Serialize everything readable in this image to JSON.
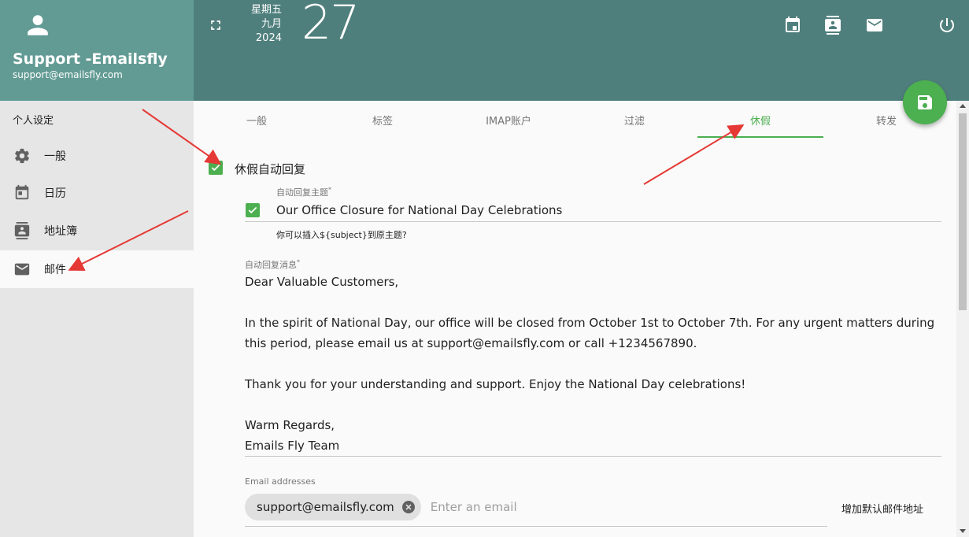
{
  "sidebar": {
    "user_name": "Support -Emailsfly",
    "user_email": "support@emailsfly.com",
    "section_title": "个人设定",
    "items": [
      {
        "label": "一般",
        "icon": "gear-icon"
      },
      {
        "label": "日历",
        "icon": "calendar-icon"
      },
      {
        "label": "地址簿",
        "icon": "contacts-icon"
      },
      {
        "label": "邮件",
        "icon": "mail-icon",
        "active": true
      }
    ]
  },
  "topbar": {
    "weekday": "星期五",
    "month": "九月",
    "year": "2024",
    "day": "27",
    "icons": [
      "calendar-icon",
      "contacts-icon",
      "mail-icon",
      "power-icon"
    ]
  },
  "tabs": [
    {
      "label": "一般"
    },
    {
      "label": "标签"
    },
    {
      "label": "IMAP账户"
    },
    {
      "label": "过滤"
    },
    {
      "label": "休假",
      "active": true
    },
    {
      "label": "转发"
    }
  ],
  "vacation": {
    "enable_label": "休假自动回复",
    "subject_label": "自动回复主题",
    "subject_value": "Our Office Closure for National Day Celebrations",
    "subject_hint": "你可以插入${subject}到原主题?",
    "message_label": "自动回复消息",
    "message_lines": [
      "Dear Valuable Customers,",
      "",
      "In the spirit of National Day, our office will be closed from October 1st to October 7th. For any urgent matters during this period, please email us at support@emailsfly.com or call +1234567890.",
      "",
      "Thank you for your understanding and support. Enjoy the National Day celebrations!",
      "",
      "Warm Regards,",
      "Emails Fly Team"
    ],
    "email_addresses_label": "Email addresses",
    "email_chip": "support@emailsfly.com",
    "email_placeholder": "Enter an email",
    "add_default_label": "增加默认邮件地址"
  },
  "colors": {
    "sidebar_header": "#629b94",
    "topbar": "#4f7f7c",
    "accent": "#4caf50",
    "annotation": "#e53935"
  }
}
